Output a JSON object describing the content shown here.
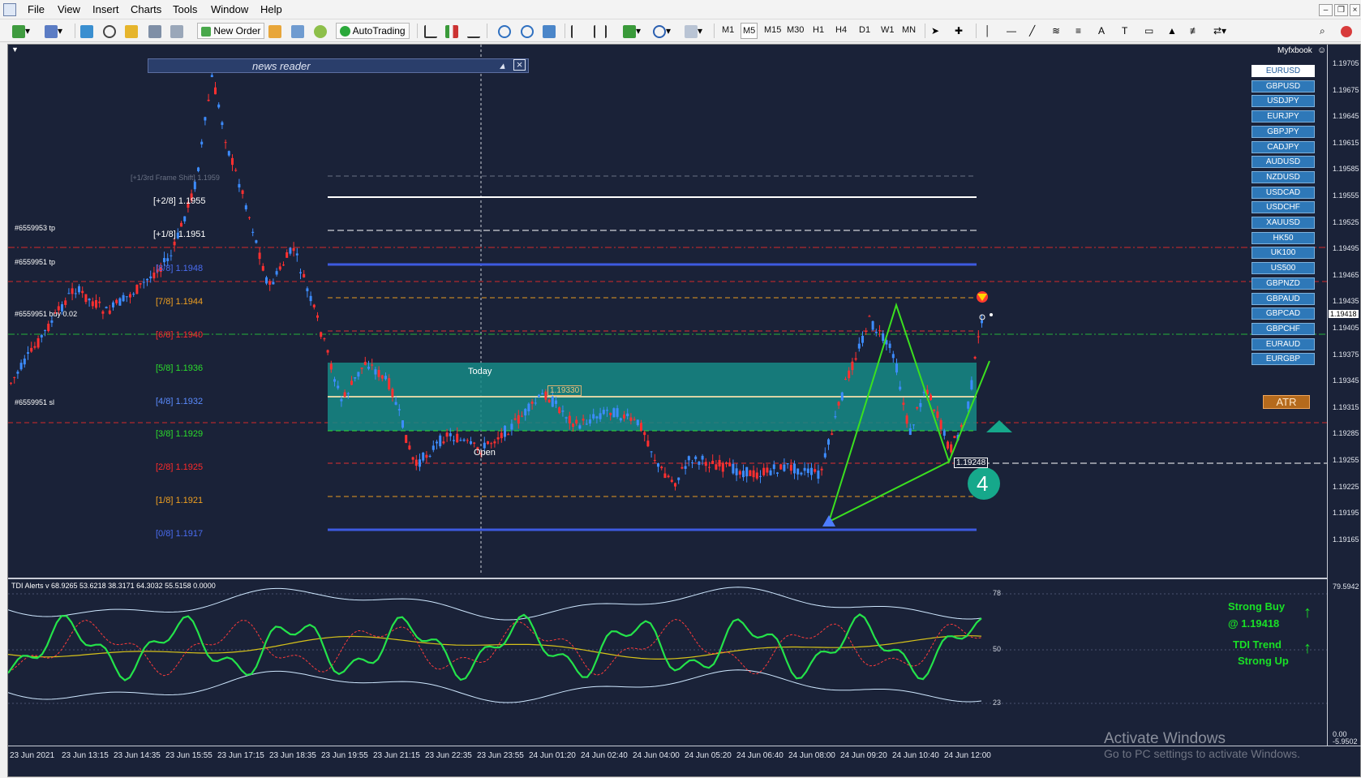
{
  "menu": [
    "File",
    "View",
    "Insert",
    "Charts",
    "Tools",
    "Window",
    "Help"
  ],
  "toolbar": {
    "new_order": "New Order",
    "autotrading": "AutoTrading",
    "timeframes": [
      "M1",
      "M5",
      "M15",
      "M30",
      "H1",
      "H4",
      "D1",
      "W1",
      "MN"
    ],
    "active_timeframe": "M5"
  },
  "chart": {
    "pair_brand": "Myfxbook",
    "news_reader": "news reader",
    "symbols": [
      "EURUSD",
      "GBPUSD",
      "USDJPY",
      "EURJPY",
      "GBPJPY",
      "CADJPY",
      "AUDUSD",
      "NZDUSD",
      "USDCAD",
      "USDCHF",
      "XAUUSD",
      "HK50",
      "UK100",
      "US500",
      "GBPNZD",
      "GBPAUD",
      "GBPCAD",
      "GBPCHF",
      "EURAUD",
      "EURGBP"
    ],
    "selected_symbol": "EURUSD",
    "atr_label": "ATR",
    "price_ticks": [
      "1.19705",
      "1.19675",
      "1.19645",
      "1.19615",
      "1.19585",
      "1.19555",
      "1.19525",
      "1.19495",
      "1.19465",
      "1.19435",
      "1.19405",
      "1.19375",
      "1.19345",
      "1.19315",
      "1.19285",
      "1.19255",
      "1.19225",
      "1.19195",
      "1.19165"
    ],
    "current_price": "1.19418",
    "ind_axis": {
      "top": "79.5942",
      "bottom": "0.00",
      "bottom2": "-5.9502"
    },
    "time_ticks": [
      "23 Jun 2021",
      "23 Jun 13:15",
      "23 Jun 14:35",
      "23 Jun 15:55",
      "23 Jun 17:15",
      "23 Jun 18:35",
      "23 Jun 19:55",
      "23 Jun 21:15",
      "23 Jun 22:35",
      "23 Jun 23:55",
      "24 Jun 01:20",
      "24 Jun 02:40",
      "24 Jun 04:00",
      "24 Jun 05:20",
      "24 Jun 06:40",
      "24 Jun 08:00",
      "24 Jun 09:20",
      "24 Jun 10:40",
      "24 Jun 12:00"
    ],
    "murrey_levels": [
      {
        "label": "[+1/3rd Frame Shift]",
        "value": "1.1959",
        "color": "#6a7285"
      },
      {
        "label": "[+2/8]",
        "value": "1.1955",
        "color": "#ffffff"
      },
      {
        "label": "[+1/8]",
        "value": "1.1951",
        "color": "#ffffff"
      },
      {
        "label": "[8/8]",
        "value": "1.1948",
        "color": "#4a6cf0"
      },
      {
        "label": "[7/8]",
        "value": "1.1944",
        "color": "#f0a020"
      },
      {
        "label": "[6/8]",
        "value": "1.1940",
        "color": "#ff2a2a"
      },
      {
        "label": "[5/8]",
        "value": "1.1936",
        "color": "#2cdc2c"
      },
      {
        "label": "[4/8]",
        "value": "1.1932",
        "color": "#5b8cff"
      },
      {
        "label": "[3/8]",
        "value": "1.1929",
        "color": "#2cdc2c"
      },
      {
        "label": "[2/8]",
        "value": "1.1925",
        "color": "#ff2a2a"
      },
      {
        "label": "[1/8]",
        "value": "1.1921",
        "color": "#f0a020"
      },
      {
        "label": "[0/8]",
        "value": "1.1917",
        "color": "#4a6cf0"
      }
    ],
    "trade_tags": {
      "tp_a": "#6559953 tp",
      "tp_b": "#6559951 tp",
      "buy": "#6559951 buy 0.02",
      "sl": "#6559951 sl"
    },
    "today_label": "Today",
    "open_label": "Open",
    "box_price": "1.19330",
    "price_box2": "1.19248",
    "pattern_number": "4",
    "indicator_header": "TDI Alerts v 68.9265 53.6218 38.3171 64.3032 55.5158 0.0000",
    "ind_levels": [
      "78",
      "50",
      "23"
    ],
    "signal": {
      "line1": "Strong Buy",
      "line2": "@ 1.19418",
      "line3": "TDI Trend",
      "line4": "Strong Up"
    },
    "watermark": {
      "line1": "Activate Windows",
      "line2": "Go to PC settings to activate Windows."
    }
  }
}
